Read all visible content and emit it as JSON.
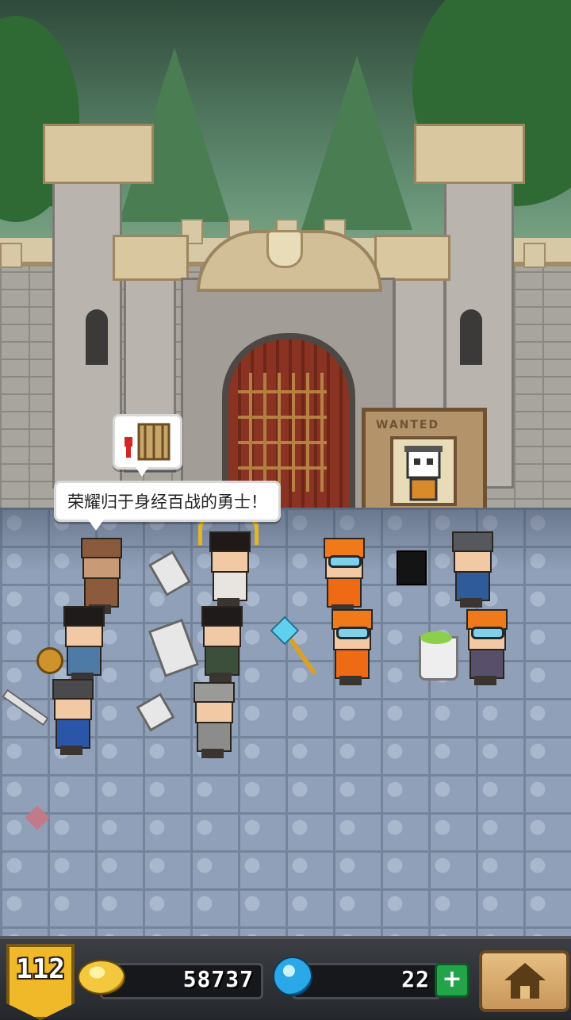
{
  "speech_bubble": {
    "text": "荣耀归于身经百战的勇士！"
  },
  "wanted_poster": {
    "title": "WANTED"
  },
  "hud": {
    "level": "112",
    "coins": "58737",
    "gems": "22",
    "add_gems_label": "+"
  },
  "colors": {
    "hud_background": "#2a2d31",
    "level_badge": "#f0b92a",
    "add_button": "#23a34a",
    "home_button": "#d9ab6e"
  },
  "icons": {
    "coin": "coin-icon",
    "gem": "gem-icon",
    "home": "home-icon",
    "gate_idea": "gate-icon"
  }
}
